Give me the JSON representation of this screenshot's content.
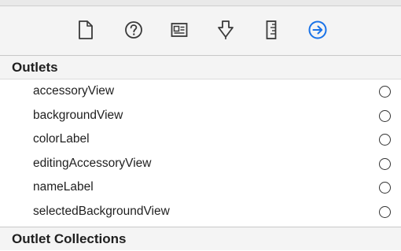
{
  "toolbar": {
    "icons": [
      {
        "name": "file-inspector-icon"
      },
      {
        "name": "quick-help-icon"
      },
      {
        "name": "identity-inspector-icon"
      },
      {
        "name": "attributes-inspector-icon"
      },
      {
        "name": "size-inspector-icon"
      },
      {
        "name": "connections-inspector-icon",
        "selected": true
      }
    ],
    "accent_color": "#1a73e8"
  },
  "outlets": {
    "title": "Outlets",
    "items": [
      {
        "label": "accessoryView"
      },
      {
        "label": "backgroundView"
      },
      {
        "label": "colorLabel"
      },
      {
        "label": "editingAccessoryView"
      },
      {
        "label": "nameLabel"
      },
      {
        "label": "selectedBackgroundView"
      }
    ]
  },
  "outlet_collections": {
    "title": "Outlet Collections"
  }
}
